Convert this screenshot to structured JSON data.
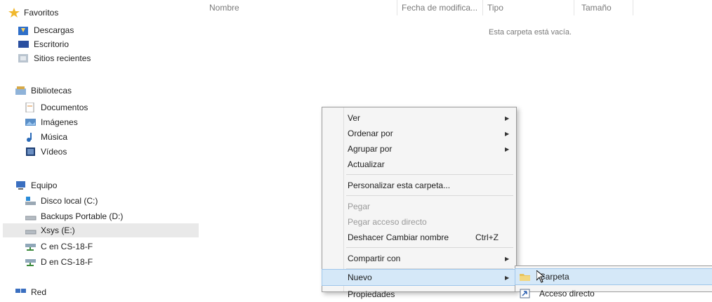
{
  "nav": {
    "favorites": "Favoritos",
    "downloads": "Descargas",
    "desktop": "Escritorio",
    "recent": "Sitios recientes",
    "libraries": "Bibliotecas",
    "documents": "Documentos",
    "pictures": "Imágenes",
    "music": "Música",
    "videos": "Vídeos",
    "computer": "Equipo",
    "disk_c": "Disco local (C:)",
    "disk_d": "Backups Portable (D:)",
    "disk_e": "Xsys (E:)",
    "net_c": "C en CS-18-F",
    "net_d": "D en CS-18-F",
    "network": "Red"
  },
  "columns": {
    "name": "Nombre",
    "date": "Fecha de modifica...",
    "type": "Tipo",
    "size": "Tamaño"
  },
  "empty_text": "Esta carpeta está vacía.",
  "context_menu": {
    "view": "Ver",
    "sort_by": "Ordenar por",
    "group_by": "Agrupar por",
    "refresh": "Actualizar",
    "customize": "Personalizar esta carpeta...",
    "paste": "Pegar",
    "paste_shortcut": "Pegar acceso directo",
    "undo": "Deshacer Cambiar nombre",
    "undo_shortcut": "Ctrl+Z",
    "share": "Compartir con",
    "new": "Nuevo",
    "properties": "Propiedades"
  },
  "submenu": {
    "folder": "Carpeta",
    "shortcut": "Acceso directo"
  },
  "colors": {
    "highlight": "#d5e8f8",
    "highlight_border": "#9fc6ea",
    "menu_bg": "#f5f5f5"
  }
}
